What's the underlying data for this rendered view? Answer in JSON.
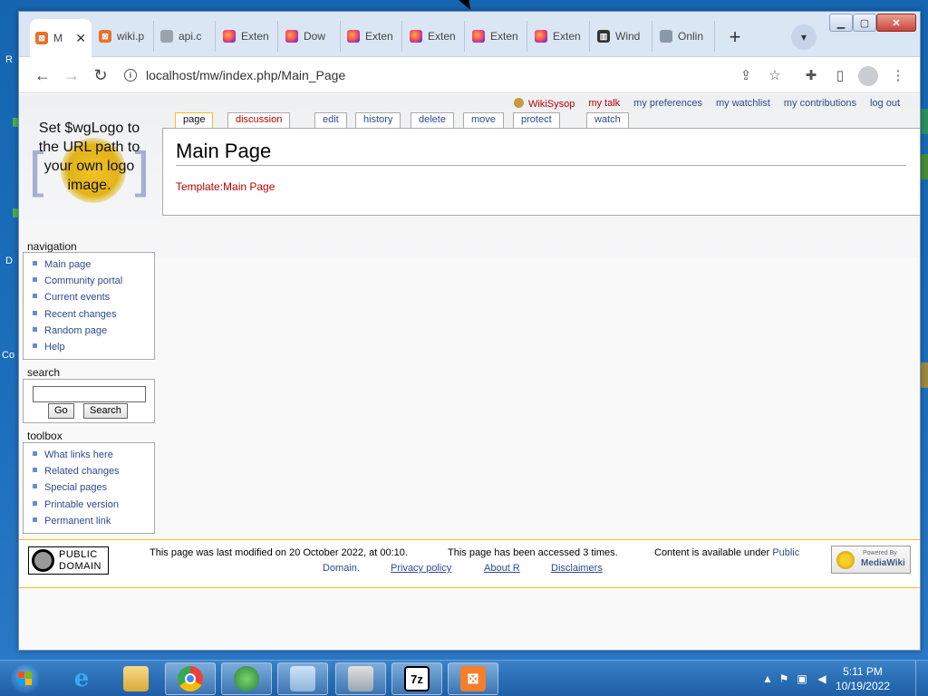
{
  "desktop": {
    "left_letters": [
      "R",
      "D",
      "Co"
    ]
  },
  "browser": {
    "tabs": [
      {
        "label": "M",
        "icon": "mediawiki-icon",
        "active": true
      },
      {
        "label": "wiki.p",
        "icon": "mediawiki-icon"
      },
      {
        "label": "api.c",
        "icon": "globe-icon"
      },
      {
        "label": "Exten",
        "icon": "firefox-icon"
      },
      {
        "label": "Dow",
        "icon": "firefox-icon"
      },
      {
        "label": "Exten",
        "icon": "firefox-icon"
      },
      {
        "label": "Exten",
        "icon": "firefox-icon"
      },
      {
        "label": "Exten",
        "icon": "firefox-icon"
      },
      {
        "label": "Exten",
        "icon": "firefox-icon"
      },
      {
        "label": "Wind",
        "icon": "column-icon"
      },
      {
        "label": "Onlin",
        "icon": "globe-icon"
      }
    ],
    "tab_close_glyph": "✕",
    "new_tab_glyph": "+",
    "url": "localhost/mw/index.php/Main_Page"
  },
  "personal": {
    "user": "WikiSysop",
    "my_talk": "my talk",
    "my_preferences": "my preferences",
    "my_watchlist": "my watchlist",
    "my_contributions": "my contributions",
    "log_out": "log out"
  },
  "logo_text": "Set $wgLogo to the URL path to your own logo image.",
  "content_tabs": {
    "page": "page",
    "discussion": "discussion",
    "edit": "edit",
    "history": "history",
    "delete": "delete",
    "move": "move",
    "protect": "protect",
    "watch": "watch"
  },
  "content": {
    "title": "Main Page",
    "body_link": "Template:Main Page"
  },
  "navigation": {
    "heading": "navigation",
    "items": [
      "Main page",
      "Community portal",
      "Current events",
      "Recent changes",
      "Random page",
      "Help"
    ]
  },
  "search": {
    "heading": "search",
    "go": "Go",
    "search": "Search",
    "value": ""
  },
  "toolbox": {
    "heading": "toolbox",
    "items": [
      "What links here",
      "Related changes",
      "Special pages",
      "Printable version",
      "Permanent link"
    ]
  },
  "footer": {
    "badge_line1": "PUBLIC",
    "badge_line2": "DOMAIN",
    "last_modified": "This page was last modified on 20 October 2022, at 00:10.",
    "accessed": "This page has been accessed 3 times.",
    "content_available": "Content is available under",
    "public": "Public",
    "domain": "Domain.",
    "privacy": "Privacy policy",
    "about": "About R",
    "disclaimers": "Disclaimers",
    "powered_small": "Powered By",
    "powered_big": "MediaWiki"
  },
  "taskbar": {
    "time": "5:11 PM",
    "date": "10/19/2022",
    "apps": [
      "internet-explorer",
      "file-explorer",
      "chrome",
      "globe-app",
      "notepad-app",
      "installer-app",
      "7zip",
      "xampp"
    ],
    "sevenzip_label": "7z"
  },
  "colors": {
    "link": "#2a4b8d",
    "red_link": "#ba0000",
    "tab_selected_border": "#fabd23"
  }
}
